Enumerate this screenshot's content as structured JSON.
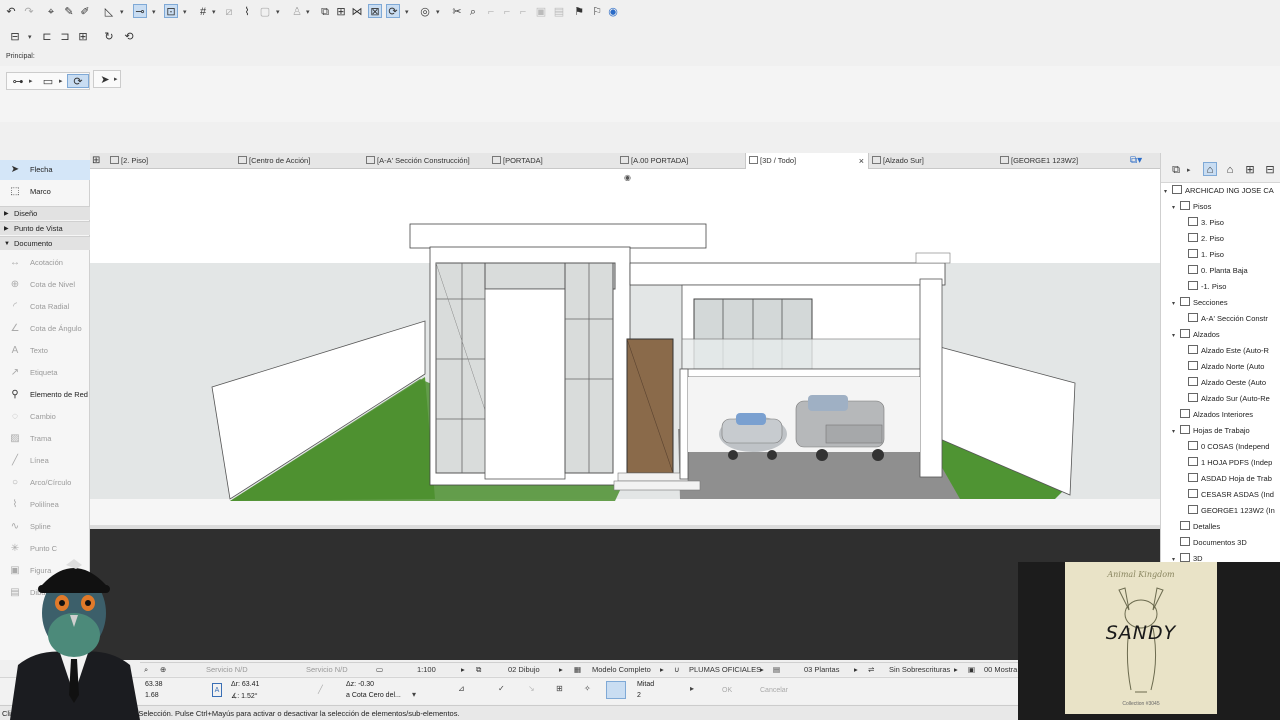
{
  "infobox": {
    "principal_label": "Principal:"
  },
  "tabs": [
    {
      "label": "[2. Piso]"
    },
    {
      "label": "[Centro de Acción]"
    },
    {
      "label": "[A-A' Sección Construcción]"
    },
    {
      "label": "[PORTADA]"
    },
    {
      "label": "[A.00 PORTADA]"
    },
    {
      "label": "[3D / Todo]",
      "active": true,
      "close": "×"
    },
    {
      "label": "[Alzado Sur]"
    },
    {
      "label": "[GEORGE1 123W2]"
    }
  ],
  "toolbox": {
    "selection": [
      {
        "label": "Flecha",
        "icon": "arrow-icon"
      },
      {
        "label": "Marco",
        "icon": "marquee-icon"
      }
    ],
    "sections": [
      {
        "label": "Diseño"
      },
      {
        "label": "Punto de Vista"
      },
      {
        "label": "Documento"
      }
    ],
    "tools": [
      {
        "label": "Acotación",
        "icon": "dimension-icon"
      },
      {
        "label": "Cota de Nivel",
        "icon": "level-dimension-icon"
      },
      {
        "label": "Cota Radial",
        "icon": "radial-dimension-icon"
      },
      {
        "label": "Cota de Ángulo",
        "icon": "angle-dimension-icon"
      },
      {
        "label": "Texto",
        "icon": "text-icon"
      },
      {
        "label": "Etiqueta",
        "icon": "label-icon"
      },
      {
        "label": "Elemento de Red",
        "icon": "grid-element-icon",
        "enabled": true
      },
      {
        "label": "Cambio",
        "icon": "change-icon"
      },
      {
        "label": "Trama",
        "icon": "fill-icon"
      },
      {
        "label": "Línea",
        "icon": "line-icon"
      },
      {
        "label": "Arco/Círculo",
        "icon": "arc-icon"
      },
      {
        "label": "Polilínea",
        "icon": "polyline-icon"
      },
      {
        "label": "Spline",
        "icon": "spline-icon"
      },
      {
        "label": "Punto C",
        "icon": "hotspot-icon"
      },
      {
        "label": "Figura",
        "icon": "figure-icon"
      },
      {
        "label": "Dibujo",
        "icon": "drawing-icon"
      }
    ]
  },
  "navigator": {
    "project": "ARCHICAD ING JOSE CA",
    "items": [
      {
        "label": "Pisos",
        "level": 1,
        "exp": "▾"
      },
      {
        "label": "3. Piso",
        "level": 2
      },
      {
        "label": "2. Piso",
        "level": 2
      },
      {
        "label": "1. Piso",
        "level": 2
      },
      {
        "label": "0. Planta Baja",
        "level": 2
      },
      {
        "label": "-1. Piso",
        "level": 2
      },
      {
        "label": "Secciones",
        "level": 1,
        "exp": "▾"
      },
      {
        "label": "A-A' Sección Constr",
        "level": 2
      },
      {
        "label": "Alzados",
        "level": 1,
        "exp": "▾"
      },
      {
        "label": "Alzado Este (Auto-R",
        "level": 2
      },
      {
        "label": "Alzado Norte (Auto",
        "level": 2
      },
      {
        "label": "Alzado Oeste (Auto",
        "level": 2
      },
      {
        "label": "Alzado Sur (Auto-Re",
        "level": 2
      },
      {
        "label": "Alzados Interiores",
        "level": 1
      },
      {
        "label": "Hojas de Trabajo",
        "level": 1,
        "exp": "▾"
      },
      {
        "label": "0 COSAS (Independ",
        "level": 2
      },
      {
        "label": "1 HOJA PDFS (Indep",
        "level": 2
      },
      {
        "label": "ASDAD Hoja de Trab",
        "level": 2
      },
      {
        "label": "CESASR ASDAS (Ind",
        "level": 2
      },
      {
        "label": "GEORGE1 123W2 (In",
        "level": 2
      },
      {
        "label": "Detalles",
        "level": 1
      },
      {
        "label": "Documentos 3D",
        "level": 1
      },
      {
        "label": "3D",
        "level": 1,
        "exp": "▾"
      }
    ]
  },
  "statusbar": {
    "servicio1": "Servicio N/D",
    "servicio2": "Servicio N/D",
    "scale": "1:100",
    "layers": "02 Dibujo",
    "model": "Modelo Completo",
    "pens": "PLUMAS OFICIALES",
    "plants": "03 Plantas",
    "override": "Sin Sobrescrituras",
    "show": "00 Mostra"
  },
  "coords": {
    "x": "63.38",
    "y": "1.68",
    "dx": "Δr: 63.41",
    "angle": "∡: 1.52°",
    "dz": "Δz: -0.30",
    "zref": "a Cota Cero del...",
    "snap_label": "Mitad",
    "snap_value": "2",
    "ok": "OK",
    "cancel": "Cancelar"
  },
  "hint": "Clic en un Elemento o dibuje un Área de Selección. Pulse Ctrl+Mayús para activar o desactivar la selección de elementos/sub-elementos.",
  "overlay": {
    "subtitle": "Animal Kingdom",
    "title": "SANDY",
    "footer": "Collection #3045"
  }
}
